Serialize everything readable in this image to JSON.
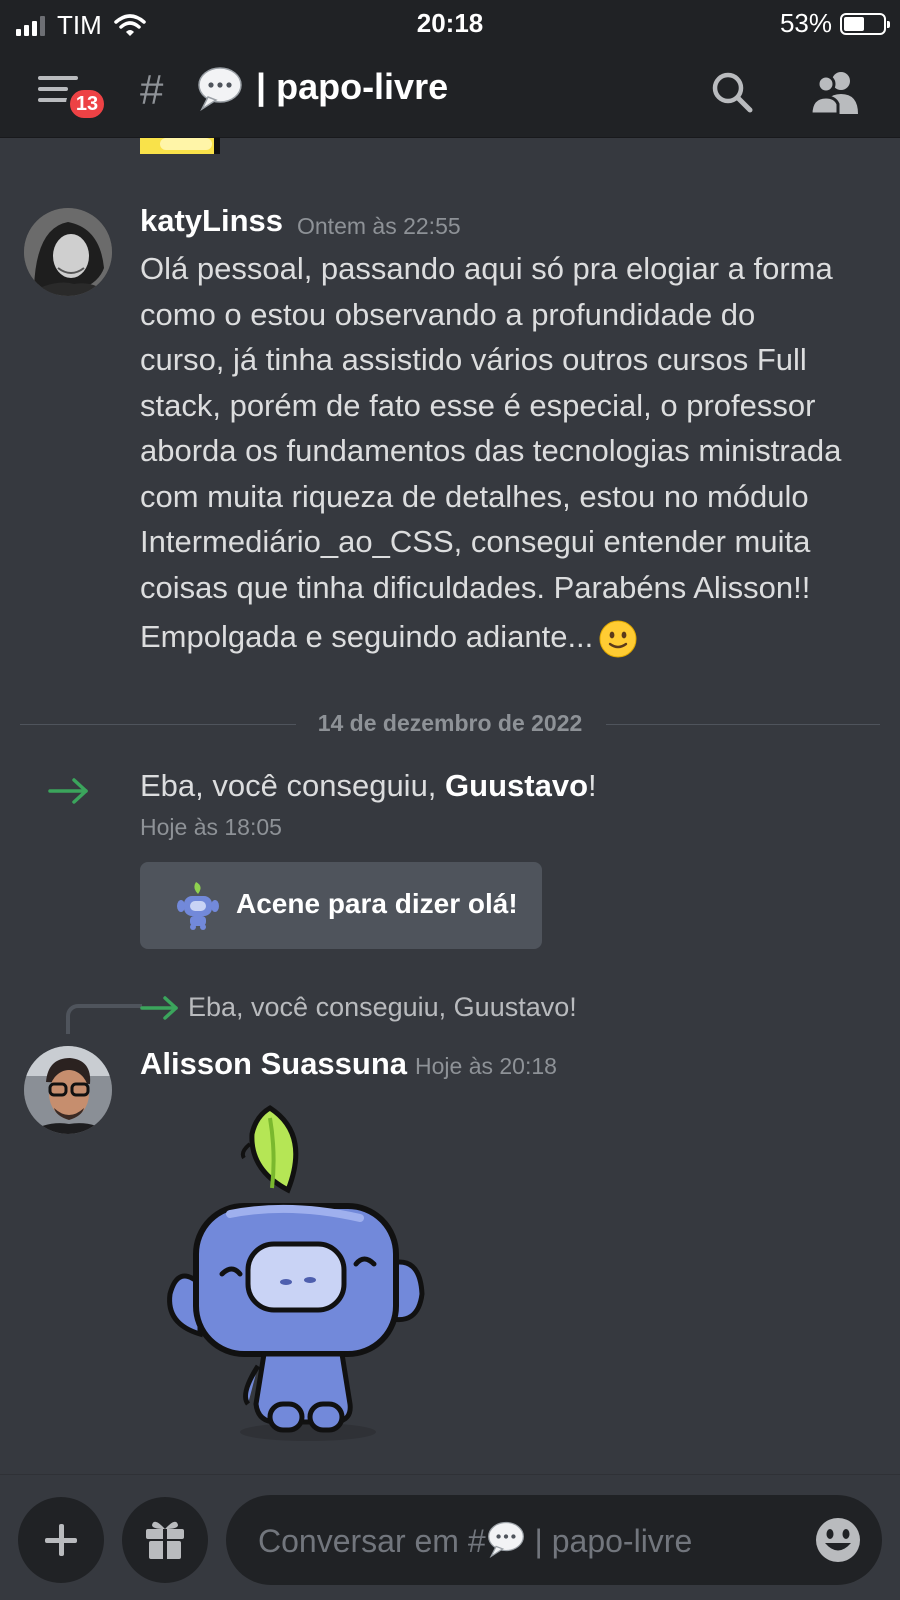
{
  "status_bar": {
    "carrier": "TIM",
    "time": "20:18",
    "battery": "53%",
    "battery_level": 0.53
  },
  "header": {
    "badge_count": "13",
    "hash": "#",
    "channel_emoji": "speech-balloon",
    "channel_name": "| papo-livre"
  },
  "messages": [
    {
      "username": "katyLinss",
      "timestamp": "Ontem às 22:55",
      "lines": [
        "Olá pessoal, passando aqui só pra elogiar  a forma",
        "como o estou observando a profundidade do",
        "curso, já tinha assistido vários outros cursos Full",
        "stack, porém de fato esse é especial, o professor",
        "aborda os fundamentos das tecnologias ministrada",
        "com muita riqueza de detalhes, estou no módulo",
        "Intermediário_ao_CSS,  consegui entender muita",
        "coisas que tinha dificuldades.  Parabéns Alisson!!",
        "Empolgada e seguindo adiante..."
      ]
    }
  ],
  "date_divider": "14 de dezembro de 2022",
  "system_message": {
    "prefix": "Eba, você conseguiu, ",
    "user": "Guustavo",
    "suffix": "!",
    "timestamp": "Hoje às 18:05",
    "wave_button": "Acene para dizer olá!"
  },
  "reply": {
    "referenced_text": "Eba, você conseguiu, Guustavo!",
    "username": "Alisson Suassuna",
    "timestamp": "Hoje às 20:18",
    "sticker": "wumpus-wave-sticker"
  },
  "composer": {
    "placeholder_prefix": "Conversar em #",
    "placeholder_suffix": " | papo-livre"
  },
  "colors": {
    "background": "#36393f",
    "header": "#202225",
    "badge": "#ed4245",
    "accent_green": "#3ba55c",
    "blurple": "#7289da"
  }
}
